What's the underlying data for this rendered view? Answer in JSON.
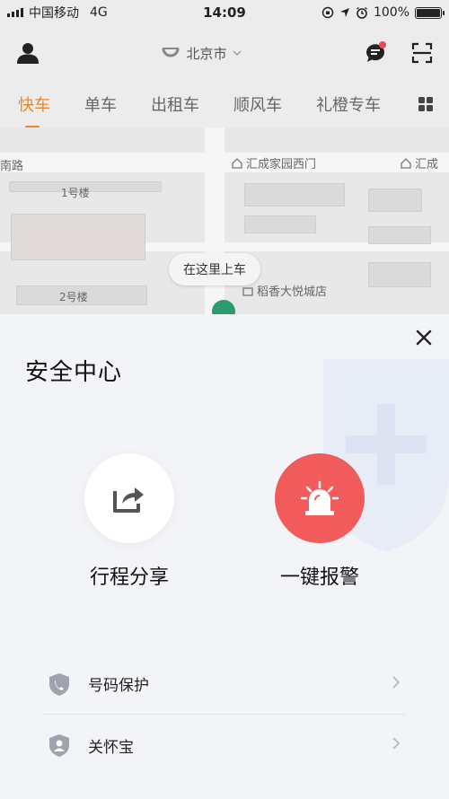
{
  "status_bar": {
    "carrier": "中国移动",
    "network": "4G",
    "time": "14:09",
    "battery": "100%"
  },
  "header": {
    "city": "北京市"
  },
  "tabs": [
    {
      "label": "快车",
      "active": true
    },
    {
      "label": "单车"
    },
    {
      "label": "出租车"
    },
    {
      "label": "顺风车"
    },
    {
      "label": "礼橙专车"
    }
  ],
  "map": {
    "road_label": "南路",
    "building_1": "1号楼",
    "building_2": "2号楼",
    "poi_1": "汇成家园西门",
    "poi_2": "汇成",
    "poi_3": "稻香大悦城店",
    "pickup_label": "在这里上车"
  },
  "sheet": {
    "title": "安全中心",
    "actions": [
      {
        "label": "行程分享",
        "icon": "share-icon"
      },
      {
        "label": "一键报警",
        "icon": "siren-icon"
      }
    ],
    "list": [
      {
        "label": "号码保护",
        "icon": "phone-shield-icon"
      },
      {
        "label": "关怀宝",
        "icon": "person-shield-icon"
      }
    ]
  },
  "colors": {
    "accent": "#f08528",
    "alarm": "#f25b5b",
    "map_pin": "#2c9c6e"
  }
}
